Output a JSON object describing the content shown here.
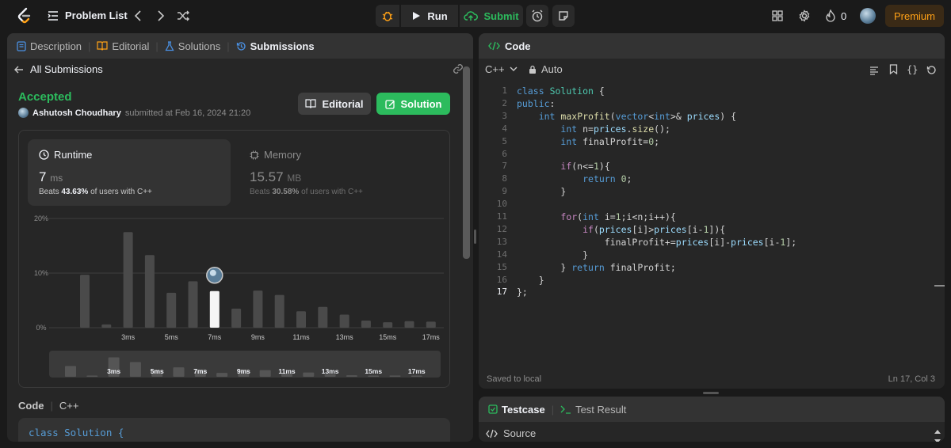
{
  "topbar": {
    "problem_list": "Problem List",
    "run": "Run",
    "submit": "Submit",
    "streak": "0",
    "premium": "Premium"
  },
  "left": {
    "tabs": [
      "Description",
      "Editorial",
      "Solutions",
      "Submissions"
    ],
    "back_label": "All Submissions",
    "status": "Accepted",
    "user": "Ashutosh Choudhary",
    "submitted_at": "submitted at Feb 16, 2024 21:20",
    "editorial_btn": "Editorial",
    "solution_btn": "Solution",
    "runtime": {
      "label": "Runtime",
      "value": "7",
      "unit": "ms",
      "beats_prefix": "Beats",
      "beats_pct": "43.63%",
      "beats_suffix": "of users with C++"
    },
    "memory": {
      "label": "Memory",
      "value": "15.57",
      "unit": "MB",
      "beats_prefix": "Beats",
      "beats_pct": "30.58%",
      "beats_suffix": "of users with C++"
    },
    "code_label": "Code",
    "code_lang": "C++",
    "code_preview": "class Solution {"
  },
  "chart_data": {
    "type": "bar",
    "title": "",
    "xlabel": "",
    "ylabel": "",
    "ylim": [
      0,
      20
    ],
    "yticks": [
      "0%",
      "10%",
      "20%"
    ],
    "xticks": [
      "3ms",
      "5ms",
      "7ms",
      "9ms",
      "11ms",
      "13ms",
      "15ms",
      "17ms"
    ],
    "categories": [
      "1ms",
      "2ms",
      "3ms",
      "4ms",
      "5ms",
      "6ms",
      "7ms",
      "8ms",
      "9ms",
      "10ms",
      "11ms",
      "12ms",
      "13ms",
      "14ms",
      "15ms",
      "16ms",
      "17ms"
    ],
    "values": [
      9.7,
      0.6,
      17.5,
      13.3,
      6.4,
      8.5,
      6.7,
      3.5,
      6.8,
      6.0,
      3.0,
      3.8,
      2.4,
      1.3,
      1.0,
      1.2,
      1.1
    ],
    "highlight_index": 6
  },
  "right": {
    "code_tab": "Code",
    "lang": "C++",
    "mode": "Auto",
    "lines": [
      "class Solution {",
      "public:",
      "    int maxProfit(vector<int>& prices) {",
      "        int n=prices.size();",
      "        int finalProfit=0;",
      "",
      "        if(n<=1){",
      "            return 0;",
      "        }",
      "",
      "        for(int i=1;i<n;i++){",
      "            if(prices[i]>prices[i-1]){",
      "                finalProfit+=prices[i]-prices[i-1];",
      "            }",
      "        } return finalProfit;",
      "    }",
      "};"
    ],
    "saved": "Saved to local",
    "cursor": "Ln 17, Col 3",
    "testcase_tab": "Testcase",
    "testresult_tab": "Test Result",
    "source": "Source"
  },
  "colors": {
    "accent_green": "#2cbb5d",
    "accent_orange": "#ffa116",
    "bg": "#1a1a1a",
    "panel": "#262626"
  }
}
